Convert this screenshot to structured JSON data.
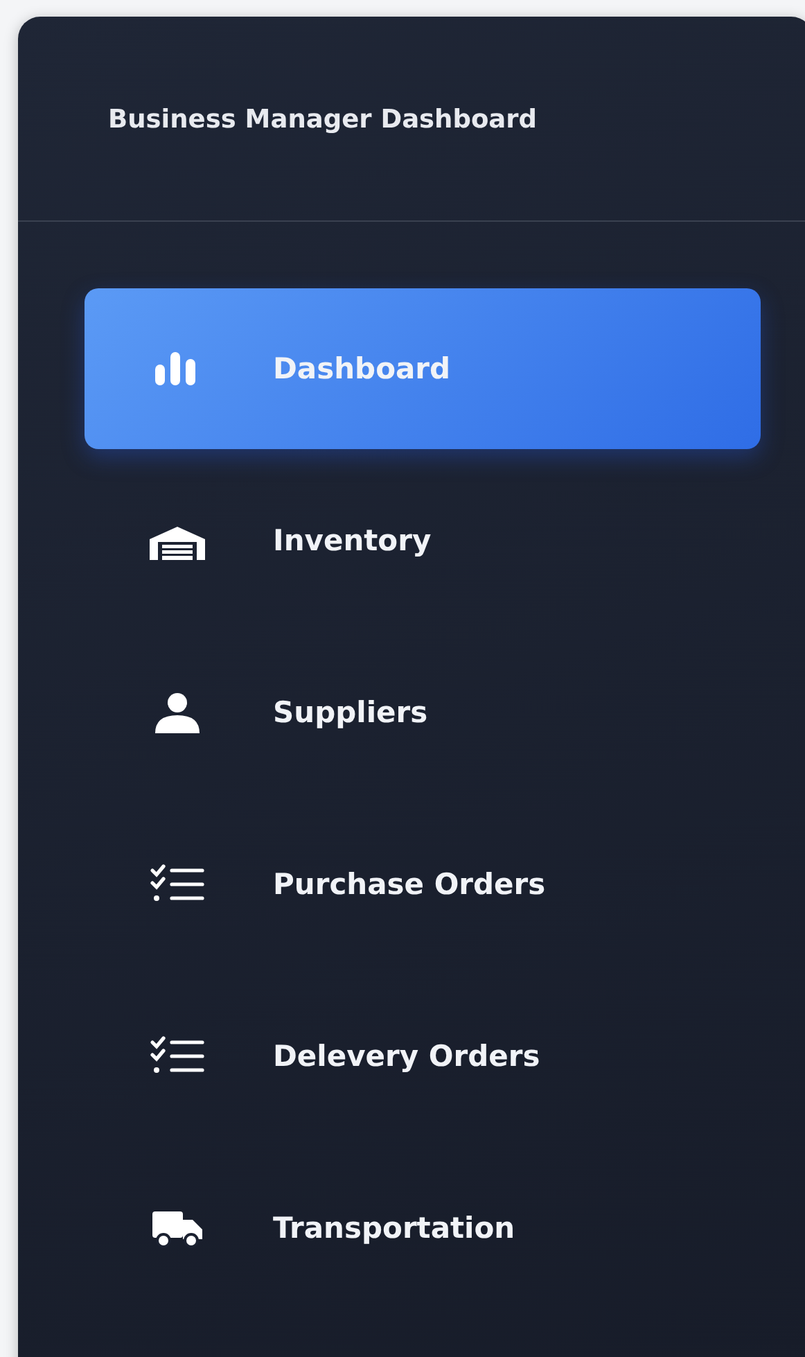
{
  "sidebar": {
    "title": "Business Manager Dashboard",
    "items": [
      {
        "label": "Dashboard",
        "kind": "chart",
        "selected": true
      },
      {
        "label": "Inventory",
        "kind": "warehouse",
        "selected": false
      },
      {
        "label": "Suppliers",
        "kind": "user",
        "selected": false
      },
      {
        "label": "Purchase Orders",
        "kind": "checklist",
        "selected": false
      },
      {
        "label": "Delevery Orders",
        "kind": "checklist",
        "selected": false
      },
      {
        "label": "Transportation",
        "kind": "truck",
        "selected": false
      }
    ]
  }
}
